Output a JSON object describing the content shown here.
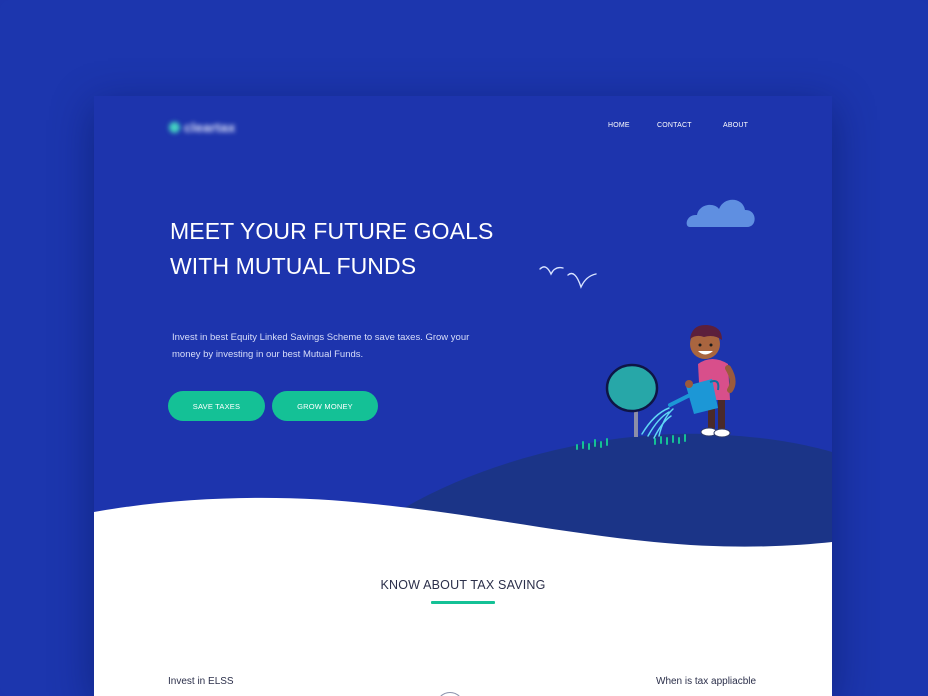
{
  "brand": {
    "name": "cleartax",
    "accent": "#14c196",
    "hero_bg": "#1d34ad",
    "outer_bg": "#1c36ae"
  },
  "nav": {
    "items": [
      {
        "label": "HOME"
      },
      {
        "label": "CONTACT"
      },
      {
        "label": "ABOUT"
      }
    ]
  },
  "hero": {
    "headline_line1": "MEET YOUR FUTURE GOALS",
    "headline_line2": "WITH MUTUAL FUNDS",
    "subtext": "Invest in best Equity Linked Savings Scheme to save taxes. Grow your money by investing in our best Mutual Funds.",
    "buttons": {
      "save_taxes": "SAVE TAXES",
      "grow_money": "GROW MONEY"
    }
  },
  "section": {
    "title": "KNOW ABOUT TAX SAVING",
    "left_heading": "Invest in ELSS",
    "right_heading": "When is tax appliacble"
  },
  "icons": {
    "cloud": "cloud-icon",
    "birds": "birds-icon",
    "child": "child-watering-plant-illustration",
    "tree": "tree-icon",
    "watering_can": "watering-can-icon"
  }
}
